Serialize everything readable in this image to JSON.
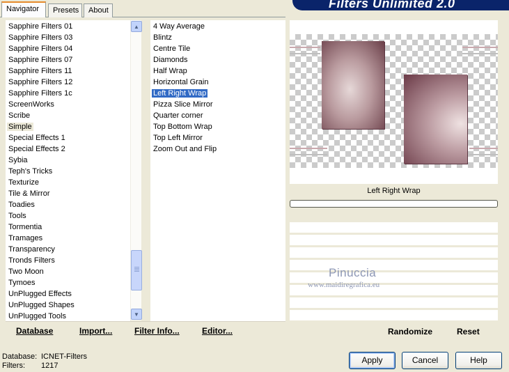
{
  "tabs": [
    {
      "label": "Navigator",
      "active": true
    },
    {
      "label": "Presets",
      "active": false
    },
    {
      "label": "About",
      "active": false
    }
  ],
  "banner": {
    "title": "Filters Unlimited 2.0"
  },
  "categories": [
    "Sapphire Filters 01",
    "Sapphire Filters 03",
    "Sapphire Filters 04",
    "Sapphire Filters 07",
    "Sapphire Filters 11",
    "Sapphire Filters 12",
    "Sapphire Filters 1c",
    "ScreenWorks",
    "Scribe",
    "Simple",
    "Special Effects 1",
    "Special Effects 2",
    "Sybia",
    "Teph's Tricks",
    "Texturize",
    "Tile & Mirror",
    "Toadies",
    "Tools",
    "Tormentia",
    "Tramages",
    "Transparency",
    "Tronds Filters",
    "Two Moon",
    "Tymoes",
    "UnPlugged Effects",
    "UnPlugged Shapes",
    "UnPlugged Tools"
  ],
  "selected_category": "Simple",
  "filters": [
    "4 Way Average",
    "Blintz",
    "Centre Tile",
    "Diamonds",
    "Half Wrap",
    "Horizontal Grain",
    "Left Right Wrap",
    "Pizza Slice Mirror",
    "Quarter corner",
    "Top Bottom Wrap",
    "Top Left Mirror",
    "Zoom Out and Flip"
  ],
  "selected_filter": "Left Right Wrap",
  "toolbar": {
    "database": "Database",
    "import": "Import...",
    "filter_info": "Filter Info...",
    "editor": "Editor...",
    "randomize": "Randomize",
    "reset": "Reset"
  },
  "preview": {
    "filter_name": "Left Right Wrap"
  },
  "watermark": {
    "line1": "Pinuccia",
    "line2": "www.maidiregrafica.eu"
  },
  "status": {
    "database_label": "Database:",
    "database_value": "ICNET-Filters",
    "filters_label": "Filters:",
    "filters_value": "1217"
  },
  "buttons": {
    "apply": "Apply",
    "cancel": "Cancel",
    "help": "Help"
  },
  "colors": {
    "selection_blue": "#316ac5",
    "banner": "#0a246a",
    "tab_highlight": "#e68b2c"
  }
}
